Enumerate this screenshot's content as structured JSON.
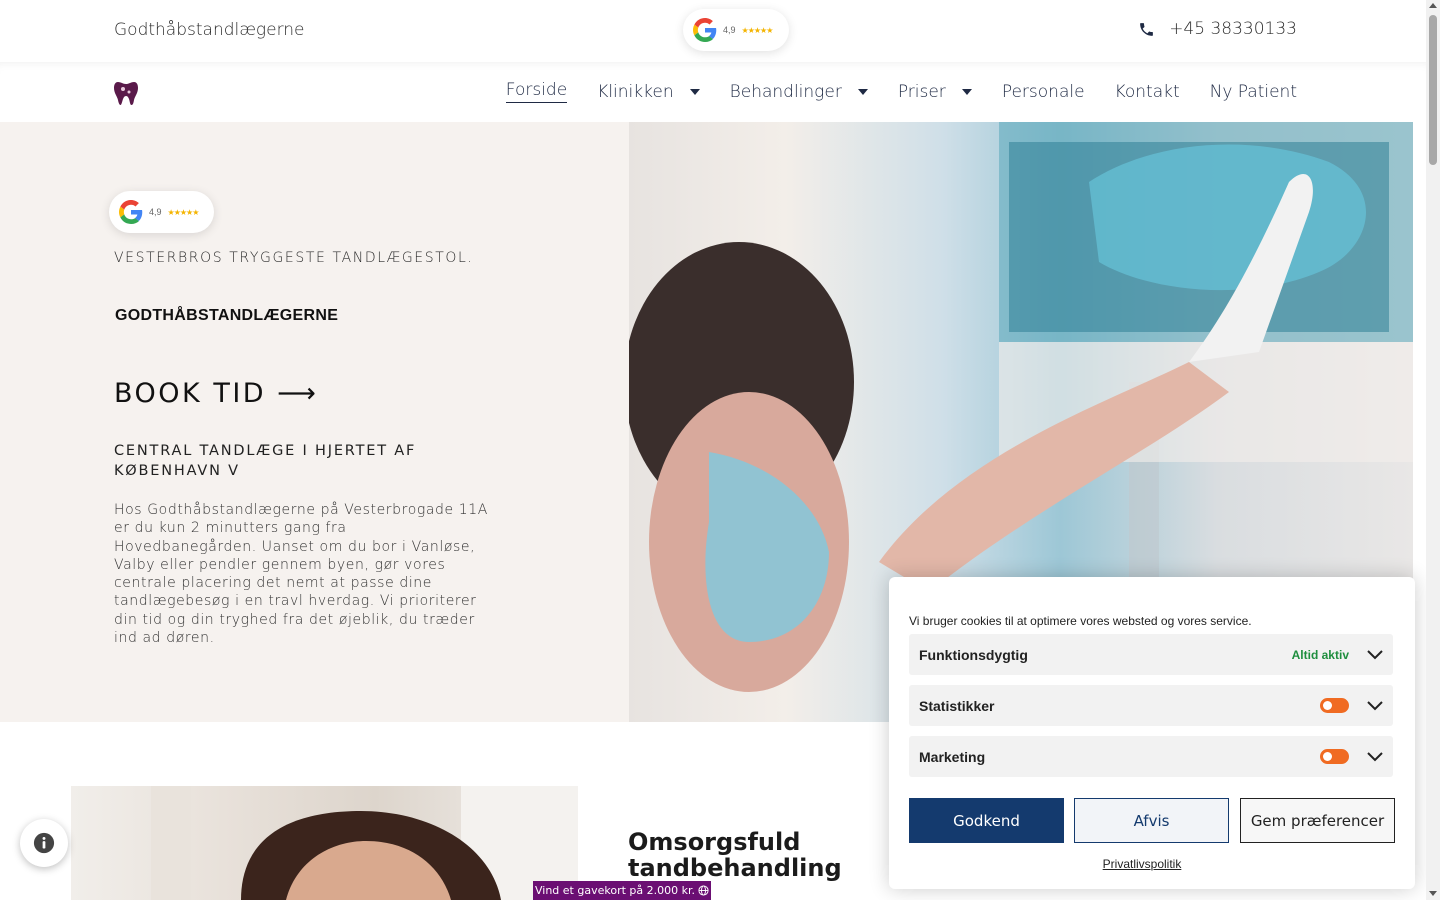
{
  "topbar": {
    "brand": "Godthåbstandlægerne",
    "rating": "4,9",
    "stars": "★★★★★",
    "phone": "+45 38330133"
  },
  "nav": {
    "items": [
      {
        "label": "Forside"
      },
      {
        "label": "Klinikken"
      },
      {
        "label": "Behandlinger"
      },
      {
        "label": "Priser"
      },
      {
        "label": "Personale"
      },
      {
        "label": "Kontakt"
      },
      {
        "label": "Ny Patient"
      }
    ]
  },
  "hero": {
    "rating": "4,9",
    "stars": "★★★★★",
    "eyebrow": "VESTERBROS TRYGGESTE TANDLÆGESTOL.",
    "brand": "GODTHÅBSTANDLÆGERNE",
    "cta": "BOOK TID ⟶",
    "subheading": "CENTRAL TANDLÆGE I HJERTET AF KØBENHAVN V",
    "paragraph": "Hos Godthåbstandlægerne på Vesterbrogade 11A er du kun 2 minutters gang fra Hovedbanegården. Uanset om du bor i Vanløse, Valby eller pendler gennem byen, gør vores centrale placering det nemt at passe dine tandlægebesøg i en travl hverdag. Vi prioriterer din tid og din tryghed fra det øjeblik, du træder ind ad døren."
  },
  "section2": {
    "title": "Omsorgsfuld tandbehandling",
    "gift": "Vind et gavekort på 2.000 kr."
  },
  "cookie": {
    "message": "Vi bruger cookies til at optimere vores websted og vores service.",
    "categories": [
      {
        "label": "Funktionsdygtig",
        "status": "Altid aktiv"
      },
      {
        "label": "Statistikker"
      },
      {
        "label": "Marketing"
      }
    ],
    "accept": "Godkend",
    "deny": "Afvis",
    "save": "Gem præferencer",
    "privacy": "Privatlivspolitik"
  },
  "colors": {
    "navy": "#1f2a44",
    "accept_bg": "#143a6e",
    "toggle": "#f06b22",
    "gift_bg": "#6b0f73",
    "hero_bg": "#f6f2ef"
  },
  "icons": [
    "google-logo-icon",
    "phone-icon",
    "clinic-logo-icon",
    "caret-down-icon",
    "chevron-down-icon",
    "info-icon",
    "globe-icon"
  ]
}
